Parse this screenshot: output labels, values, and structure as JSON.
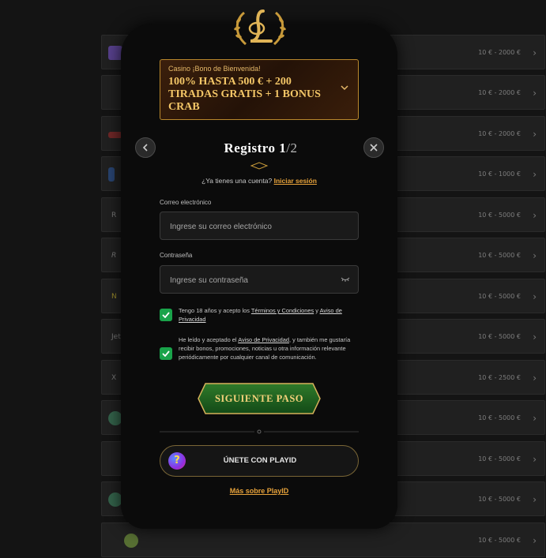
{
  "background": {
    "rows": [
      {
        "range": "10 € - 2000 €",
        "logo": "purple"
      },
      {
        "range": "10 € - 2000 €",
        "logo": ""
      },
      {
        "range": "10 € - 2000 €",
        "logo": "red"
      },
      {
        "range": "10 € - 1000 €",
        "logo": "blue"
      },
      {
        "range": "10 € - 5000 €",
        "logo": "R"
      },
      {
        "range": "10 € - 5000 €",
        "logo": "R"
      },
      {
        "range": "10 € - 5000 €",
        "logo": "N"
      },
      {
        "range": "10 € - 5000 €",
        "logo": "Jet"
      },
      {
        "range": "10 € - 2500 €",
        "logo": "X"
      },
      {
        "range": "10 € - 5000 €",
        "logo": "green"
      },
      {
        "range": "10 € - 5000 €",
        "logo": ""
      },
      {
        "range": "10 € - 5000 €",
        "logo": "green"
      },
      {
        "range": "10 € - 5000 €",
        "logo": "coin"
      }
    ]
  },
  "promo": {
    "small": "Casino ¡Bono de Bienvenida!",
    "big": "100% HASTA 500 € + 200 TIRADAS GRATIS + 1 BONUS CRAB"
  },
  "title": {
    "main": "Registro 1",
    "step": "/2"
  },
  "login": {
    "question": "¿Ya tienes una cuenta?",
    "link": "Iniciar sesión"
  },
  "email": {
    "label": "Correo electrónico",
    "placeholder": "Ingrese su correo electrónico"
  },
  "password": {
    "label": "Contraseña",
    "placeholder": "Ingrese su contraseña"
  },
  "terms": {
    "prefix": "Tengo 18 años y acepto los ",
    "terms_link": "Términos y Condiciones",
    "and": " y ",
    "privacy_link": "Aviso de Privacidad"
  },
  "marketing": {
    "prefix": "He leído y aceptado el ",
    "privacy_link": "Aviso de Privacidad",
    "rest": ", y también me gustaría recibir bonos, promociones, noticias u otra información relevante periódicamente por cualquier canal de comunicación."
  },
  "next_button": "SIGUIENTE PASO",
  "separator": "o",
  "playid": {
    "label": "ÚNETE CON PLAYID",
    "logo": "?"
  },
  "more_link": "Más sobre PlayID",
  "colors": {
    "accent": "#e8a33b",
    "check": "#19a34a",
    "gold": "#c89a3a"
  }
}
